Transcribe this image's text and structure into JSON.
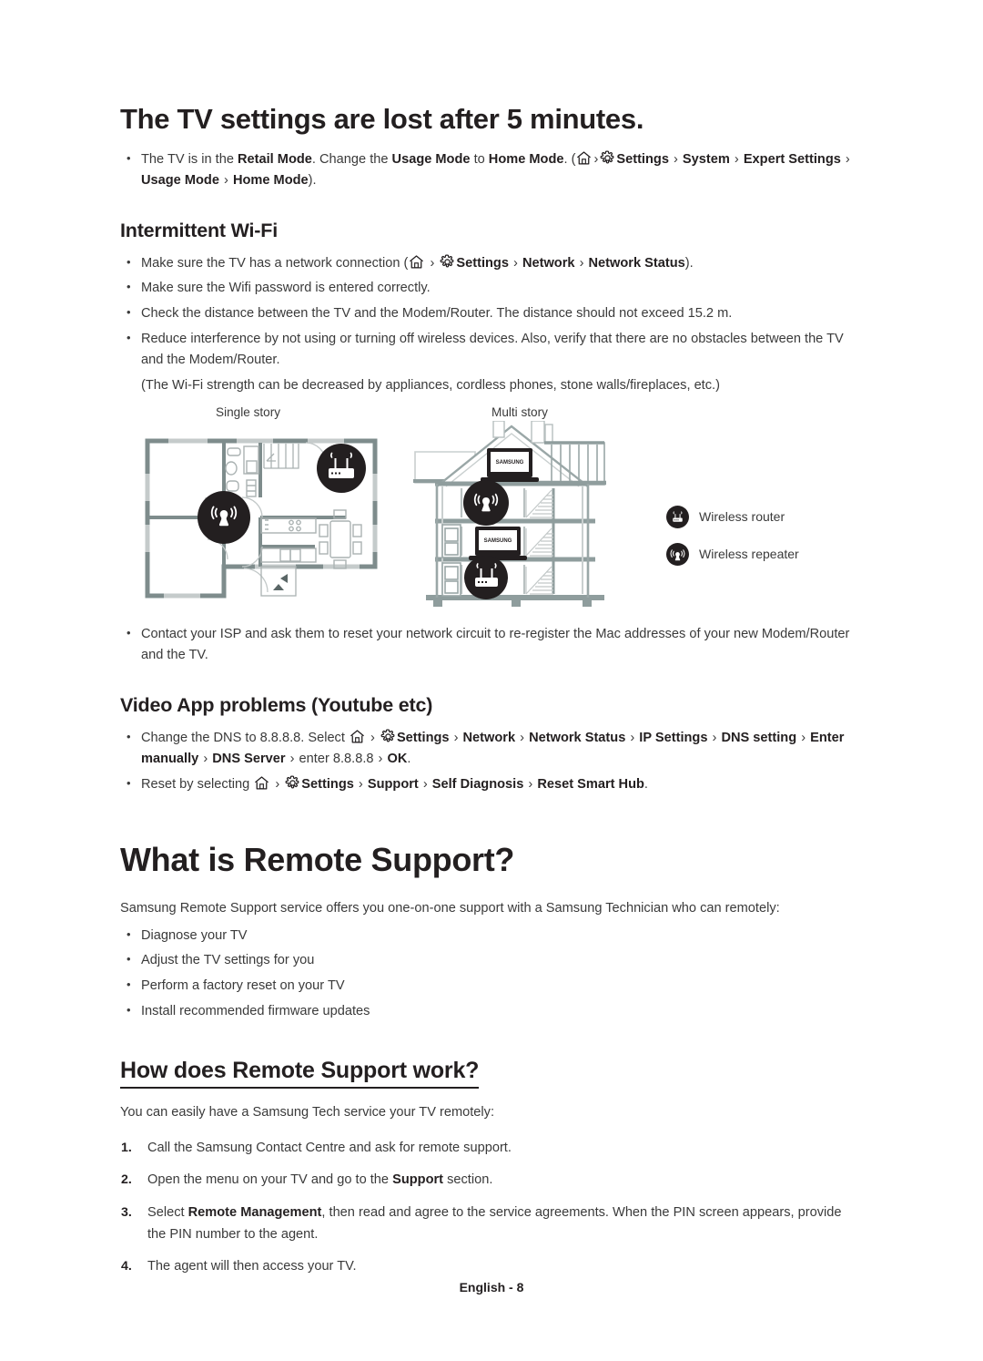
{
  "page": {
    "footer": "English - 8"
  },
  "sections": {
    "tv_settings_lost": {
      "heading": "The TV settings are lost after 5 minutes.",
      "bullet1": {
        "p1": "The TV is in the ",
        "b1": "Retail Mode",
        "p2": ". Change the ",
        "b2": "Usage Mode",
        "p3": " to ",
        "b3": "Home Mode",
        "p4": ". (",
        "icon_home": "home-icon",
        "chev": "›",
        "icon_gear": "gear-icon",
        "b4": "Settings",
        "b5": "System",
        "b6": "Expert Settings",
        "b7": "Usage Mode",
        "b8": "Home Mode",
        "p5": ")."
      }
    },
    "intermittent_wifi": {
      "heading": "Intermittent Wi-Fi",
      "bullet1": {
        "p1": "Make sure the TV has a network connection (",
        "b1": "Settings",
        "b2": "Network",
        "b3": "Network Status",
        "p2": ")."
      },
      "bullet2": "Make sure the Wifi password is entered correctly.",
      "bullet3": "Check the distance between the TV and the Modem/Router. The distance should not exceed 15.2 m.",
      "bullet4": "Reduce interference by not using or turning off wireless devices. Also, verify that there are no obstacles between the TV and the Modem/Router.",
      "note": "(The Wi-Fi strength can be decreased by appliances, cordless phones, stone walls/fireplaces, etc.)",
      "figure": {
        "label_single": "Single story",
        "label_multi": "Multi story",
        "legend": [
          {
            "icon": "wireless-router-icon",
            "label": "Wireless router"
          },
          {
            "icon": "wireless-repeater-icon",
            "label": "Wireless repeater"
          }
        ],
        "tv_brand": "SAMSUNG"
      },
      "bullet5": "Contact your ISP and ask them to reset your network circuit to re-register the Mac addresses of your new Modem/Router and the TV."
    },
    "video_app_problems": {
      "heading": "Video App problems (Youtube etc)",
      "bullet1": {
        "p1": "Change the DNS to 8.8.8.8. Select ",
        "b1": "Settings",
        "b2": "Network",
        "b3": "Network Status",
        "b4": "IP Settings",
        "b5": "DNS setting",
        "b6": "Enter manually",
        "b7": "DNS Server",
        "p2": "enter 8.8.8.8",
        "b8": "OK",
        "p3": "."
      },
      "bullet2": {
        "p1": "Reset by selecting ",
        "b1": "Settings",
        "b2": "Support",
        "b3": "Self Diagnosis",
        "b4": "Reset Smart Hub",
        "p2": "."
      }
    },
    "what_is_remote_support": {
      "heading": "What is Remote Support?",
      "intro": "Samsung Remote Support service offers you one-on-one support with a Samsung Technician who can remotely:",
      "bullets": [
        "Diagnose your TV",
        "Adjust the TV settings for you",
        "Perform a factory reset on your TV",
        "Install recommended firmware updates"
      ]
    },
    "how_does_remote_support_work": {
      "heading": "How does Remote Support work?",
      "intro": "You can easily have a Samsung Tech service your TV remotely:",
      "step1": "Call the Samsung Contact Centre and ask for remote support.",
      "step2": {
        "p1": "Open the menu on your TV and go to the ",
        "b1": "Support",
        "p2": " section."
      },
      "step3": {
        "p1": "Select ",
        "b1": "Remote Management",
        "p2": ", then read and agree to the service agreements. When the PIN screen appears, provide the PIN number to the agent."
      },
      "step4": "The agent will then access your TV."
    }
  },
  "colors": {
    "text": "#3a3a3a",
    "heading": "#231f20",
    "wall": "#7e8c8c",
    "wall_light": "#c9cfcf",
    "icon_circle": "#231f20"
  }
}
